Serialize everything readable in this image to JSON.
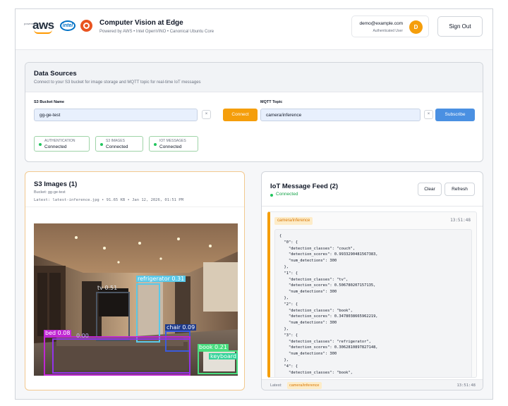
{
  "header": {
    "aws_small": "powered by",
    "aws_logo": "aws",
    "intel_logo": "intel",
    "title": "Computer Vision at Edge",
    "subtitle": "Powered by AWS • Intel OpenVINO • Canonical Ubuntu Core",
    "user_email": "demo@example.com",
    "user_status": "Authenticated User",
    "avatar_initial": "D",
    "signout_label": "Sign Out"
  },
  "data_sources": {
    "title": "Data Sources",
    "subtitle": "Connect to your S3 bucket for image storage and MQTT topic for real-time IoT messages",
    "bucket_label": "S3 Bucket Name",
    "bucket_value": "gg-ge-test",
    "connect_label": "Connect",
    "topic_label": "MQTT Topic",
    "topic_value": "camera/inference",
    "subscribe_label": "Subscribe",
    "clear_glyph": "×",
    "statuses": [
      {
        "name": "AUTHENTICATION",
        "value": "Connected"
      },
      {
        "name": "S3 IMAGES",
        "value": "Connected"
      },
      {
        "name": "IOT MESSAGES",
        "value": "Connected"
      }
    ]
  },
  "s3": {
    "title": "S3 Images (1)",
    "bucket": "Bucket: gg-ge-test",
    "latest": "Latest: latest-inference.jpg • 91.65 KB • Jan 12, 2026, 01:51 PM",
    "detections": [
      {
        "label": "refrigerator 0.31",
        "color": "#5ac8e8"
      },
      {
        "label": "tv 0.51",
        "color": "#6b7280"
      },
      {
        "label": "chair 0.09",
        "color": "#3b5bdb"
      },
      {
        "label": "bed 0.08",
        "color": "#c026d3"
      },
      {
        "label": "0.00",
        "color": "#9333ea"
      },
      {
        "label": "book 0.21",
        "color": "#4ade80"
      },
      {
        "label": "keyboard",
        "color": "#34d399"
      }
    ]
  },
  "iot": {
    "title": "IoT Message Feed (2)",
    "status": "Connected",
    "clear_label": "Clear",
    "refresh_label": "Refresh",
    "message": {
      "topic": "camera/inference",
      "time": "13:51:48",
      "payload": "{\n  \"0\": {\n    \"detection_classes\": \"couch\",\n    \"detection_scores\": 0.9933290481567383,\n    \"num_detections\": 300\n  },\n  \"1\": {\n    \"detection_classes\": \"tv\",\n    \"detection_scores\": 0.506780207157135,\n    \"num_detections\": 300\n  },\n  \"2\": {\n    \"detection_classes\": \"book\",\n    \"detection_scores\": 0.3478038665962219,\n    \"num_detections\": 300\n  },\n  \"3\": {\n    \"detection_classes\": \"refrigerator\",\n    \"detection_scores\": 0.3062810897827148,\n    \"num_detections\": 300\n  },\n  \"4\": {\n    \"detection_classes\": \"book\","
    },
    "footer": {
      "label": "Latest:",
      "topic": "camera/inference",
      "time": "13:51:48"
    }
  },
  "colors": {
    "accent_orange": "#f59e0b",
    "accent_blue": "#4a90e2",
    "status_green": "#22c55e"
  }
}
